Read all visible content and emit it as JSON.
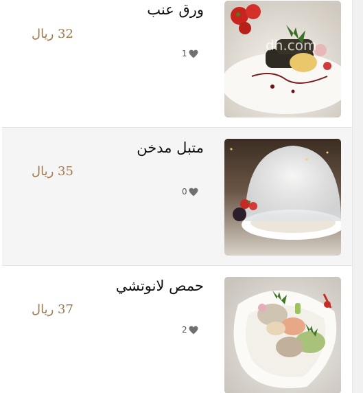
{
  "currency_label": "ريال",
  "items": [
    {
      "name": "ورق عنب",
      "price": "32 ريال",
      "likes": "1",
      "photo_watermark": "dh.com"
    },
    {
      "name": "متبل مدخن",
      "price": "35 ريال",
      "likes": "0"
    },
    {
      "name": "حمص لانوتشي",
      "price": "37 ريال",
      "likes": "2"
    }
  ],
  "colors": {
    "price": "#a0784a",
    "alt_row_bg": "#f5f5f5",
    "divider": "#e3e3e3",
    "heart": "#707070"
  }
}
